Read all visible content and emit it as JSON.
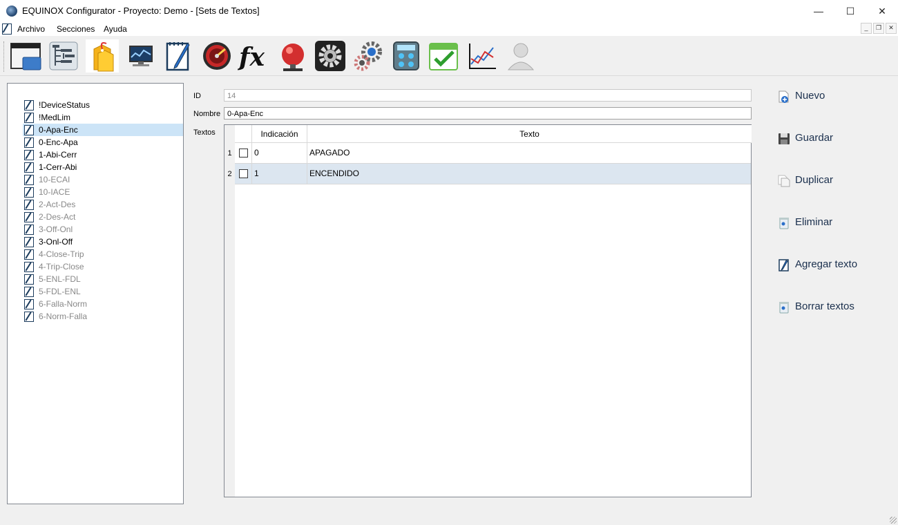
{
  "window": {
    "title": "EQUINOX Configurator - Proyecto: Demo - [Sets de Textos]",
    "minimize": "—",
    "maximize": "☐",
    "close": "✕"
  },
  "menu": {
    "items": [
      "Archivo",
      "Secciones",
      "Ayuda"
    ]
  },
  "toolbar": {
    "icons": [
      "window-icon",
      "tree-icon",
      "tags-icon",
      "monitor-icon",
      "notepad-icon",
      "gauge-icon",
      "function-icon",
      "alarm-bell-icon",
      "gear-icon",
      "gears-icon",
      "calculator-icon",
      "calendar-check-icon",
      "line-chart-icon",
      "user-icon"
    ]
  },
  "tree": {
    "items": [
      {
        "label": "!DeviceStatus",
        "dim": false
      },
      {
        "label": "!MedLim",
        "dim": false
      },
      {
        "label": "0-Apa-Enc",
        "dim": false,
        "selected": true
      },
      {
        "label": "0-Enc-Apa",
        "dim": false
      },
      {
        "label": "1-Abi-Cerr",
        "dim": false
      },
      {
        "label": "1-Cerr-Abi",
        "dim": false
      },
      {
        "label": "10-ECAI",
        "dim": true
      },
      {
        "label": "10-IACE",
        "dim": true
      },
      {
        "label": "2-Act-Des",
        "dim": true
      },
      {
        "label": "2-Des-Act",
        "dim": true
      },
      {
        "label": "3-Off-Onl",
        "dim": true
      },
      {
        "label": "3-Onl-Off",
        "dim": false
      },
      {
        "label": "4-Close-Trip",
        "dim": true
      },
      {
        "label": "4-Trip-Close",
        "dim": true
      },
      {
        "label": "5-ENL-FDL",
        "dim": true
      },
      {
        "label": "5-FDL-ENL",
        "dim": true
      },
      {
        "label": "6-Falla-Norm",
        "dim": true
      },
      {
        "label": "6-Norm-Falla",
        "dim": true
      }
    ]
  },
  "form": {
    "id_label": "ID",
    "id_value": "14",
    "name_label": "Nombre",
    "name_value": "0-Apa-Enc",
    "texts_label": "Textos"
  },
  "grid": {
    "headers": {
      "indication": "Indicación",
      "text": "Texto"
    },
    "rows": [
      {
        "num": "1",
        "indication": "0",
        "text": "APAGADO"
      },
      {
        "num": "2",
        "indication": "1",
        "text": "ENCENDIDO"
      }
    ]
  },
  "actions": {
    "new": "Nuevo",
    "save": "Guardar",
    "duplicate": "Duplicar",
    "delete": "Eliminar",
    "add_text": "Agregar texto",
    "delete_texts": "Borrar textos"
  }
}
